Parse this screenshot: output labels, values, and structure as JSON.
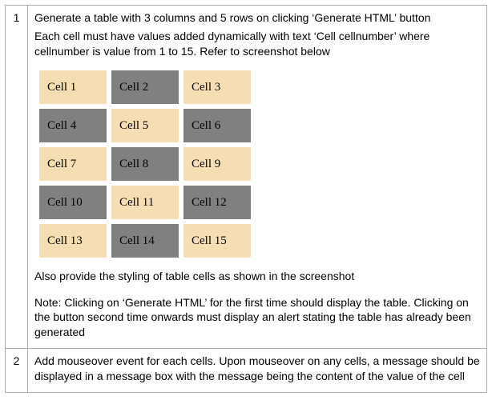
{
  "rows": [
    {
      "num": "1",
      "para1": "Generate a table with 3 columns and 5 rows on clicking ‘Generate HTML’ button",
      "para2": "Each cell must have values added dynamically with text ‘Cell cellnumber’ where cellnumber is value from 1 to 15. Refer to screenshot below",
      "cells": [
        [
          {
            "label": "Cell 1",
            "cls": "cell-wheat"
          },
          {
            "label": "Cell 2",
            "cls": "cell-gray"
          },
          {
            "label": "Cell 3",
            "cls": "cell-wheat"
          }
        ],
        [
          {
            "label": "Cell 4",
            "cls": "cell-gray"
          },
          {
            "label": "Cell 5",
            "cls": "cell-wheat"
          },
          {
            "label": "Cell 6",
            "cls": "cell-gray"
          }
        ],
        [
          {
            "label": "Cell 7",
            "cls": "cell-wheat"
          },
          {
            "label": "Cell 8",
            "cls": "cell-gray"
          },
          {
            "label": "Cell 9",
            "cls": "cell-wheat"
          }
        ],
        [
          {
            "label": "Cell 10",
            "cls": "cell-gray"
          },
          {
            "label": "Cell 11",
            "cls": "cell-wheat"
          },
          {
            "label": "Cell 12",
            "cls": "cell-gray"
          }
        ],
        [
          {
            "label": "Cell 13",
            "cls": "cell-wheat"
          },
          {
            "label": "Cell 14",
            "cls": "cell-gray"
          },
          {
            "label": "Cell 15",
            "cls": "cell-wheat"
          }
        ]
      ],
      "para3": "Also provide the styling of table cells as shown in the screenshot",
      "para4": "Note: Clicking on ‘Generate HTML’ for the first time should display the table. Clicking on the button second time onwards must display an alert stating the table has already been generated"
    },
    {
      "num": "2",
      "para1": "Add mouseover event for each cells. Upon mouseover on any cells, a message should be displayed in a message box with the message being the content of the value of the cell"
    }
  ]
}
